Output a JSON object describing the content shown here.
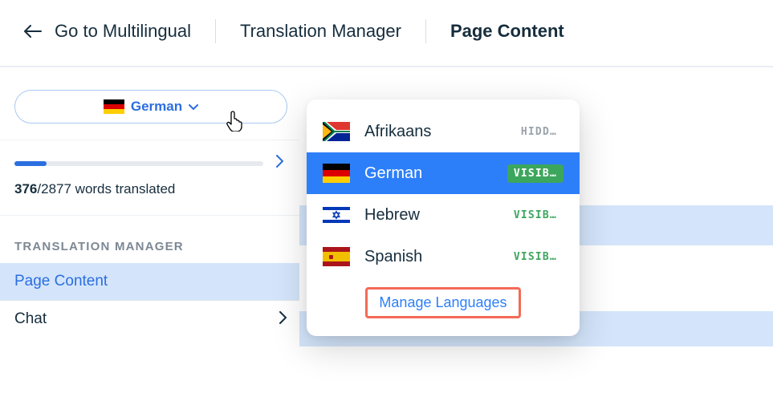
{
  "header": {
    "back_label": "Go to Multilingual",
    "crumbs": [
      "Translation Manager",
      "Page Content"
    ]
  },
  "pill": {
    "language_label": "German"
  },
  "progress": {
    "done": "376",
    "total": "2877",
    "suffix": " words translated",
    "percent": 13
  },
  "section_label": "TRANSLATION MANAGER",
  "nav": [
    {
      "label": "Page Content",
      "active": true
    },
    {
      "label": "Chat",
      "active": false
    }
  ],
  "dropdown": {
    "items": [
      {
        "name": "Afrikaans",
        "flag": "za",
        "status": "HIDD…",
        "status_kind": "hidden",
        "selected": false
      },
      {
        "name": "German",
        "flag": "de",
        "status": "VISIB…",
        "status_kind": "visib",
        "selected": true
      },
      {
        "name": "Hebrew",
        "flag": "il",
        "status": "VISIB…",
        "status_kind": "visib",
        "selected": false
      },
      {
        "name": "Spanish",
        "flag": "es",
        "status": "VISIB…",
        "status_kind": "visib",
        "selected": false
      }
    ],
    "manage_label": "Manage Languages"
  },
  "colors": {
    "accent": "#2d7ff9",
    "highlight_box": "#f46a57",
    "green": "#3ca65d"
  }
}
